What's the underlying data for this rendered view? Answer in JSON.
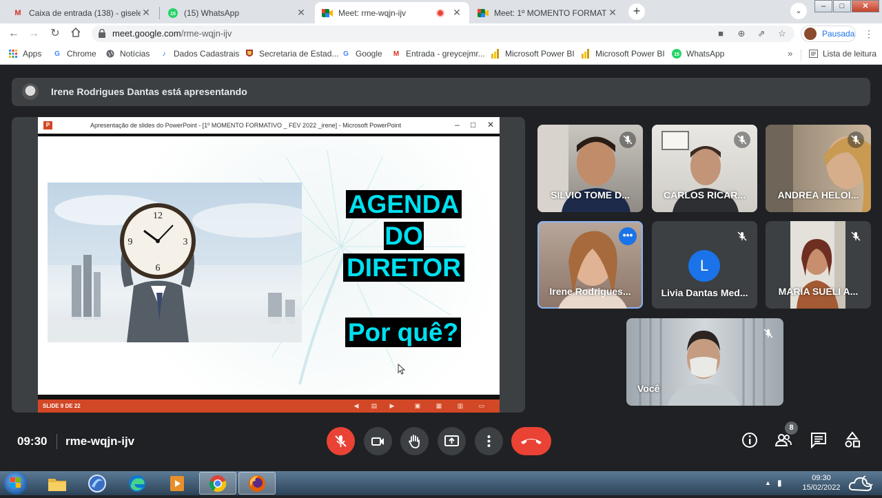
{
  "browser": {
    "tabs": [
      {
        "title": "Caixa de entrada (138) - giseleac",
        "icon": "gmail-icon"
      },
      {
        "title": "(15) WhatsApp",
        "icon": "whatsapp-icon"
      },
      {
        "title": "Meet: rme-wqjn-ijv",
        "icon": "meet-icon",
        "active": true,
        "recording": true
      },
      {
        "title": "Meet: 1º MOMENTO FORMATIVO",
        "icon": "meet-icon"
      }
    ],
    "url_host": "meet.google.com",
    "url_path": "/rme-wqjn-ijv",
    "profile_label": "Pausada",
    "bookmarks": [
      {
        "label": "Apps",
        "icon": "apps-grid-icon"
      },
      {
        "label": "Chrome",
        "icon": "google-icon"
      },
      {
        "label": "Notícias",
        "icon": "globe-icon"
      },
      {
        "label": "Dados Cadastrais",
        "icon": "bookmark-icon"
      },
      {
        "label": "Secretaria de Estad...",
        "icon": "crest-icon"
      },
      {
        "label": "Google",
        "icon": "google-icon"
      },
      {
        "label": "Entrada - greycejmr...",
        "icon": "gmail-icon"
      },
      {
        "label": "Microsoft Power BI",
        "icon": "powerbi-icon"
      },
      {
        "label": "Microsoft Power BI",
        "icon": "powerbi-icon"
      },
      {
        "label": "WhatsApp",
        "icon": "whatsapp-icon"
      }
    ],
    "reading_list": "Lista de leitura"
  },
  "meet": {
    "presenter_banner": "Irene Rodrigues Dantas está apresentando",
    "presentation": {
      "window_title": "Apresentação de slides do PowerPoint - [1º MOMENTO FORMATIVO _ FEV 2022 _irene] - Microsoft PowerPoint",
      "slide_lines": [
        "AGENDA",
        "DO",
        "DIRETOR",
        "Por quê?"
      ],
      "slide_counter": "SLIDE 9 DE 22"
    },
    "participants": [
      {
        "name": "SILVIO TOME D...",
        "muted": true
      },
      {
        "name": "CARLOS RICAR...",
        "muted": true
      },
      {
        "name": "ANDREA HELOI...",
        "muted": true
      },
      {
        "name": "Irene Rodrigues...",
        "muted": false,
        "speaking": true
      },
      {
        "name": "Livia Dantas Med...",
        "muted": true,
        "initial": "L",
        "avatar_color": "#1a73e8"
      },
      {
        "name": "MARIA SUELI A...",
        "muted": true
      },
      {
        "name": "Você",
        "muted": true
      }
    ],
    "time": "09:30",
    "meeting_code": "rme-wqjn-ijv",
    "people_count": "8",
    "colors": {
      "background": "#202124",
      "tile": "#3c4043",
      "end_call": "#ea4335",
      "mic_off": "#ea4335"
    }
  },
  "taskbar": {
    "time": "09:30",
    "date": "15/02/2022"
  }
}
